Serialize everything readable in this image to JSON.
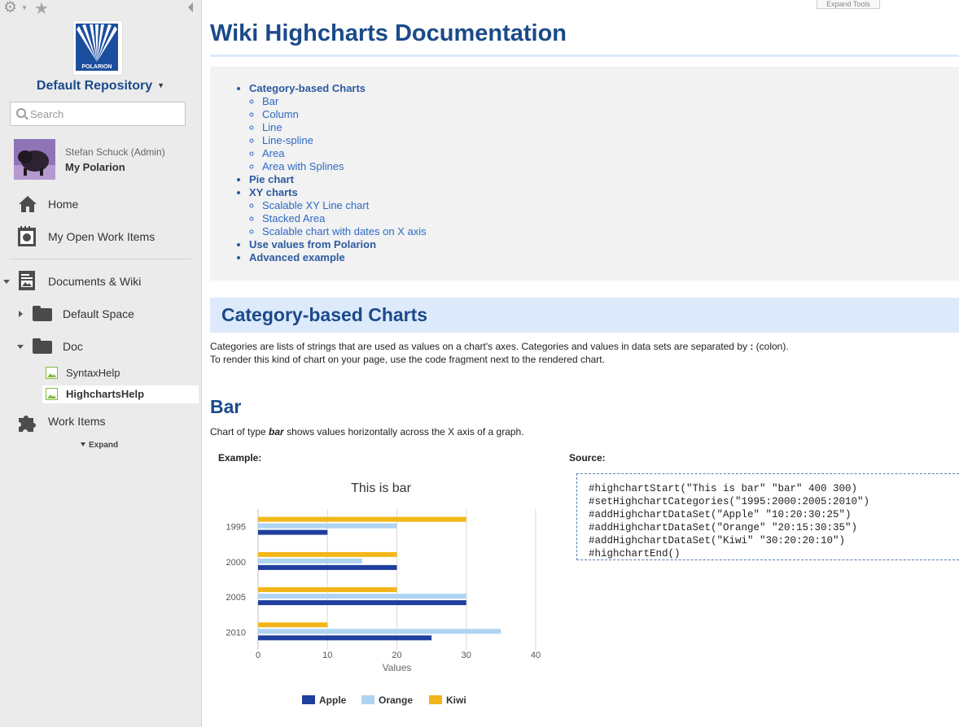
{
  "sidebar": {
    "repository": "Default Repository",
    "search_placeholder": "Search",
    "user_name": "Stefan Schuck (Admin)",
    "my_polarion": "My Polarion",
    "nav": {
      "home": "Home",
      "open_work_items": "My Open Work Items",
      "documents_wiki": "Documents & Wiki",
      "default_space": "Default Space",
      "doc": "Doc",
      "syntax_help": "SyntaxHelp",
      "highcharts_help": "HighchartsHelp",
      "work_items": "Work Items",
      "expand": "Expand"
    },
    "logo_text": "POLARION"
  },
  "main": {
    "expand_tools": "Expand Tools",
    "title": "Wiki Highcharts Documentation",
    "toc": {
      "category": "Category-based Charts",
      "bar": "Bar",
      "column": "Column",
      "line": "Line",
      "line_spline": "Line-spline",
      "area": "Area",
      "area_splines": "Area with Splines",
      "pie": "Pie chart",
      "xy": "XY charts",
      "scalable_xy": "Scalable XY Line chart",
      "stacked_area": "Stacked Area",
      "scalable_dates": "Scalable chart with dates on X axis",
      "use_values": "Use values from Polarion",
      "advanced": "Advanced example"
    },
    "section_heading": "Category-based Charts",
    "section_text_1_pre": "Categories are lists of strings that are used as values on a chart's axes. Categories and values in data sets are separated by ",
    "section_text_1_colon": ":",
    "section_text_1_post": " (colon).",
    "section_text_2": "To render this kind of chart on your page, use the code fragment next to the rendered chart.",
    "bar_heading": "Bar",
    "bar_desc_pre": "Chart of type ",
    "bar_desc_em": "bar",
    "bar_desc_post": " shows values horizontally across the X axis of a graph.",
    "example_label": "Example:",
    "source_label": "Source:",
    "code_lines": [
      "#highchartStart(\"This is bar\" \"bar\" 400 300)",
      "#setHighchartCategories(\"1995:2000:2005:2010\")",
      "#addHighchartDataSet(\"Apple\" \"10:20:30:25\")",
      "#addHighchartDataSet(\"Orange\" \"20:15:30:35\")",
      "#addHighchartDataSet(\"Kiwi\" \"30:20:20:10\")",
      "#highchartEnd()"
    ]
  },
  "colors": {
    "heading": "#1b4a8a",
    "apple": "#1f3f9e",
    "orange": "#aed4f2",
    "kiwi": "#f2b619"
  },
  "chart_data": {
    "type": "bar",
    "title": "This is bar",
    "categories": [
      "1995",
      "2000",
      "2005",
      "2010"
    ],
    "series": [
      {
        "name": "Kiwi",
        "color": "#f2b619",
        "values": [
          30,
          20,
          20,
          10
        ]
      },
      {
        "name": "Orange",
        "color": "#aed4f2",
        "values": [
          20,
          15,
          30,
          35
        ]
      },
      {
        "name": "Apple",
        "color": "#1f3f9e",
        "values": [
          10,
          20,
          30,
          25
        ]
      }
    ],
    "legend_order": [
      "Apple",
      "Orange",
      "Kiwi"
    ],
    "xlabel": "Values",
    "xlim": [
      0,
      40
    ],
    "ticks": [
      0,
      10,
      20,
      30,
      40
    ],
    "legend": "bottom-center"
  }
}
